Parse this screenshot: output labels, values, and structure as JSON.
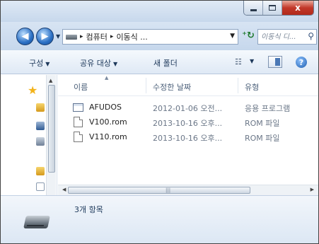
{
  "window": {
    "controls": {
      "minimize_icon": "minimize-icon",
      "maximize_icon": "maximize-icon",
      "close_glyph": "x"
    }
  },
  "address": {
    "breadcrumbs": [
      "컴퓨터",
      "이동식 ..."
    ],
    "separator": "▸",
    "search_placeholder": "이동식 디...",
    "refresh_glyph": "⁺↻"
  },
  "toolbar": {
    "organize": "구성",
    "share": "공유 대상",
    "new_folder": "새 폴더",
    "dropdown_glyph": "▼"
  },
  "columns": {
    "name": "이름",
    "modified": "수정한 날짜",
    "type": "유형"
  },
  "files": [
    {
      "name": "AFUDOS",
      "modified": "2012-01-06 오전...",
      "type": "응용 프로그램",
      "icon": "application-icon"
    },
    {
      "name": "V100.rom",
      "modified": "2013-10-16 오후...",
      "type": "ROM 파일",
      "icon": "file-icon"
    },
    {
      "name": "V110.rom",
      "modified": "2013-10-16 오후...",
      "type": "ROM 파일",
      "icon": "file-icon"
    }
  ],
  "status": {
    "item_count": "3개 항목"
  },
  "colors": {
    "title_text": "#1e395b",
    "close_button": "#c2382a",
    "favorites_star": "#f3b31a"
  }
}
